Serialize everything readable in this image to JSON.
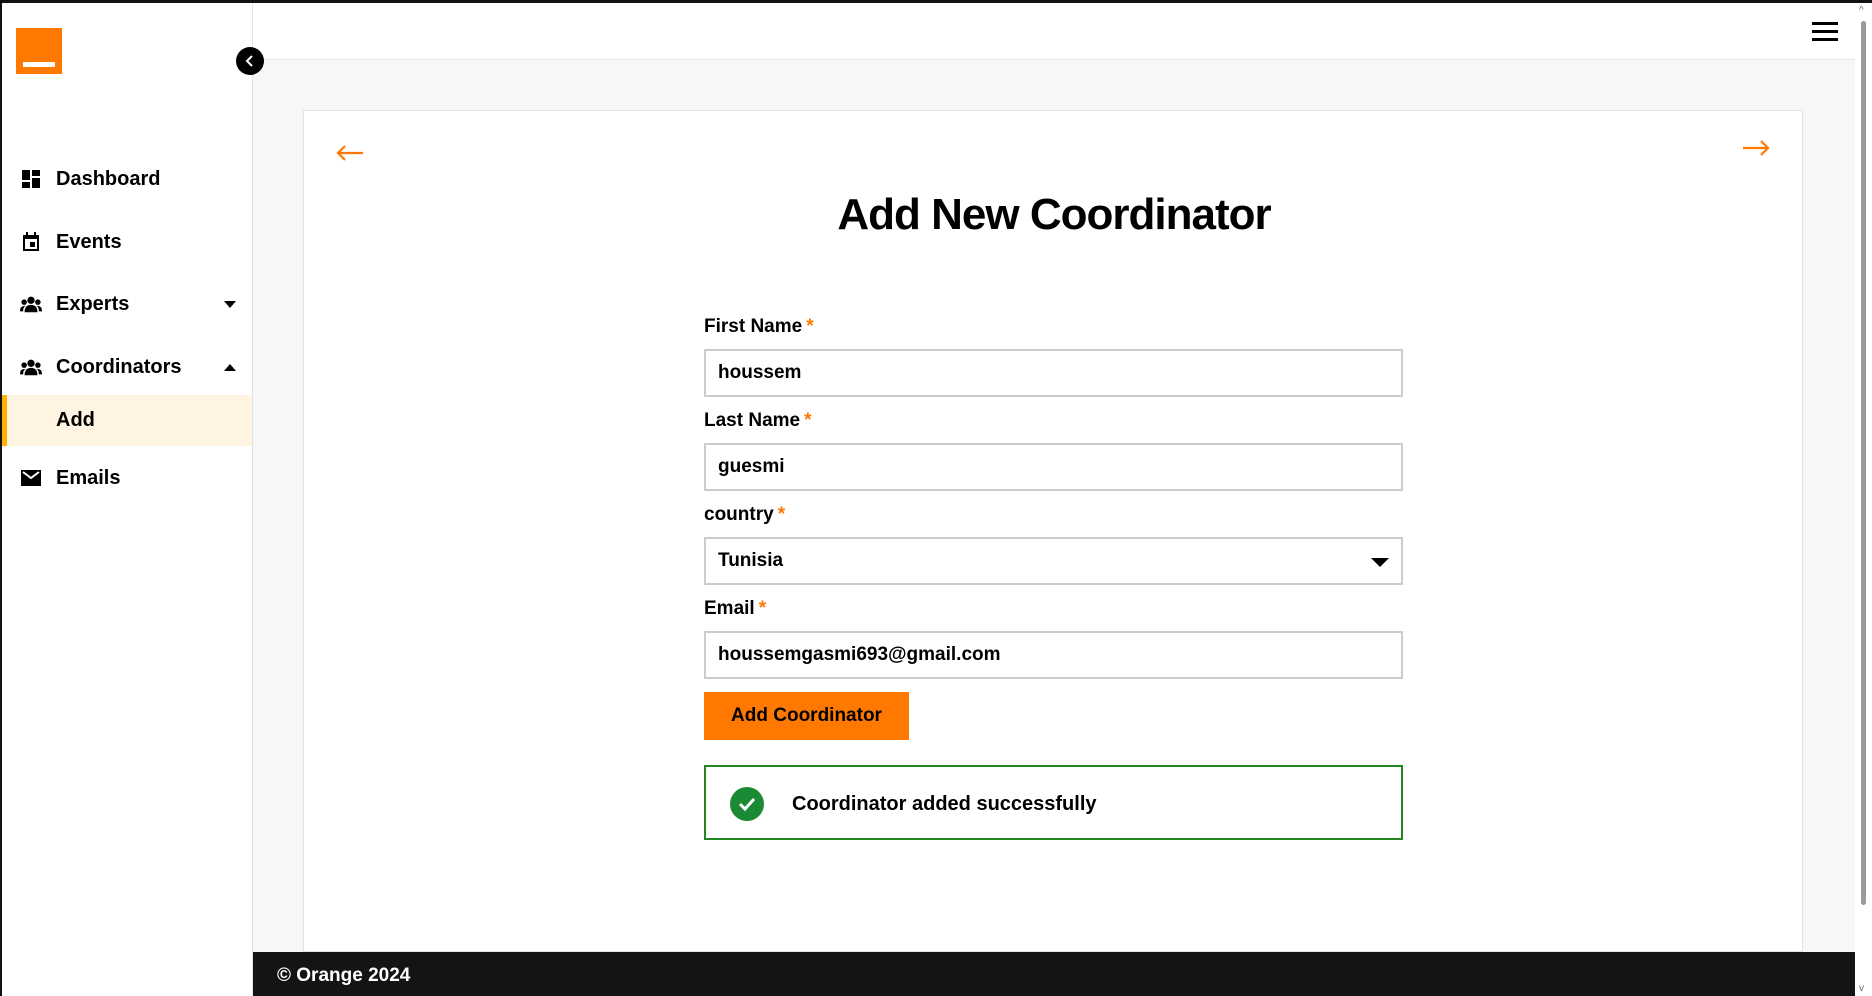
{
  "sidebar": {
    "items": [
      {
        "label": "Dashboard",
        "icon": "dashboard-icon"
      },
      {
        "label": "Events",
        "icon": "calendar-icon"
      },
      {
        "label": "Experts",
        "icon": "users-icon",
        "expanded": false
      },
      {
        "label": "Coordinators",
        "icon": "users-icon",
        "expanded": true
      },
      {
        "label": "Emails",
        "icon": "envelope-icon"
      }
    ],
    "sub_item": {
      "label": "Add"
    }
  },
  "page": {
    "title": "Add New Coordinator"
  },
  "form": {
    "first_name": {
      "label": "First Name",
      "required": "*",
      "value": "houssem"
    },
    "last_name": {
      "label": "Last Name",
      "required": "*",
      "value": "guesmi"
    },
    "country": {
      "label": "country",
      "required": "*",
      "value": "Tunisia"
    },
    "email": {
      "label": "Email",
      "required": "*",
      "value": "houssemgasmi693@gmail.com"
    },
    "submit_label": "Add Coordinator"
  },
  "alert": {
    "message": "Coordinator added successfully"
  },
  "footer": {
    "text": "© Orange 2024"
  },
  "colors": {
    "brand": "#ff7900",
    "active_bg": "#fff4e2",
    "active_border": "#ffb400",
    "success": "#228722",
    "footer_bg": "#141414"
  }
}
